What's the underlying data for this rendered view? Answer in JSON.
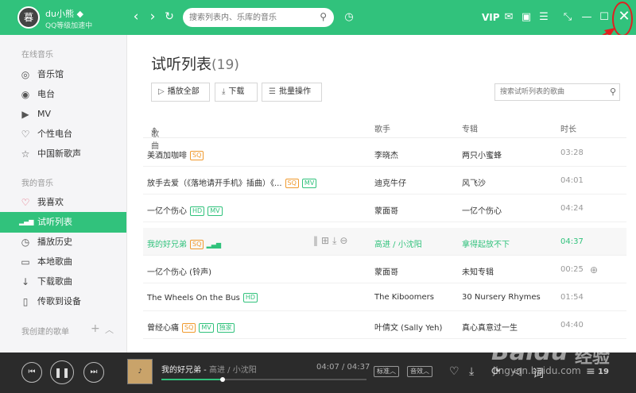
{
  "app": {
    "user_name": "du小熊",
    "user_status": "QQ等级加速中",
    "avatar_text": "暮",
    "search_placeholder": "搜索列表内、乐库的音乐",
    "vip_label": "VIP"
  },
  "sidebar": {
    "sections": [
      {
        "title": "在线音乐",
        "items": [
          {
            "icon": "music-hall-icon",
            "glyph": "◎",
            "label": "音乐馆"
          },
          {
            "icon": "radio-icon",
            "glyph": "◉",
            "label": "电台"
          },
          {
            "icon": "mv-icon",
            "glyph": "▶",
            "label": "MV"
          },
          {
            "icon": "personal-radio-icon",
            "glyph": "♡",
            "label": "个性电台"
          },
          {
            "icon": "new-songs-icon",
            "glyph": "☆",
            "label": "中国新歌声"
          }
        ]
      },
      {
        "title": "我的音乐",
        "items": [
          {
            "icon": "heart-icon",
            "glyph": "♡",
            "label": "我喜欢"
          },
          {
            "icon": "equalizer-icon",
            "glyph": "▮",
            "label": "试听列表",
            "active": true
          },
          {
            "icon": "history-icon",
            "glyph": "◷",
            "label": "播放历史"
          },
          {
            "icon": "local-music-icon",
            "glyph": "▭",
            "label": "本地歌曲"
          },
          {
            "icon": "download-icon",
            "glyph": "↓",
            "label": "下载歌曲"
          },
          {
            "icon": "device-icon",
            "glyph": "▯",
            "label": "传歌到设备"
          }
        ]
      },
      {
        "title": "我创建的歌单",
        "items": []
      }
    ]
  },
  "main": {
    "title": "试听列表",
    "count": "(19)",
    "toolbar": {
      "play_all": "播放全部",
      "download": "下载",
      "batch": "批量操作",
      "search_placeholder": "搜索试听列表的歌曲"
    },
    "columns": {
      "song": "歌曲",
      "artist": "歌手",
      "album": "专辑",
      "duration": "时长"
    },
    "songs": [
      {
        "title": "美酒加咖啡",
        "tags": [
          "SQ"
        ],
        "artist": "李晓杰",
        "album": "两只小蜜蜂",
        "duration": "03:28"
      },
      {
        "title": "放手去爱（《落地请开手机》插曲）《...",
        "tags": [
          "SQ",
          "MV"
        ],
        "artist": "迪克牛仔",
        "album": "风飞沙",
        "duration": "04:01"
      },
      {
        "title": "一亿个伤心",
        "tags": [
          "HD",
          "MV"
        ],
        "artist": "蒙面哥",
        "album": "一亿个伤心",
        "duration": "04:24"
      },
      {
        "title": "我的好兄弟",
        "tags": [
          "SQ"
        ],
        "artist": "高进 / 小沈阳",
        "album": "拿得起放不下",
        "duration": "04:37",
        "playing": true
      },
      {
        "title": "一亿个伤心 (铃声)",
        "tags": [],
        "artist": "蒙面哥",
        "album": "未知专辑",
        "duration": "00:25"
      },
      {
        "title": "The Wheels On the Bus",
        "tags": [
          "HD"
        ],
        "artist": "The Kiboomers",
        "album": "30 Nursery Rhymes",
        "duration": "01:54"
      },
      {
        "title": "曾经心痛",
        "tags": [
          "SQ",
          "MV",
          "独家"
        ],
        "artist": "叶倩文 (Sally Yeh)",
        "album": "真心真意过一生",
        "duration": "04:40"
      }
    ]
  },
  "player": {
    "track_title": "我的好兄弟",
    "track_artist": "高进 / 小沈阳",
    "time": "04:07 / 04:37",
    "quality": "标准",
    "effect": "音效",
    "progress": 0.3,
    "list_count": "19"
  },
  "watermark": {
    "brand": "Baidu",
    "label": "经验",
    "url": "jingyan.baidu.com"
  },
  "colors": {
    "accent": "#31c27c",
    "sq_tag": "#f09a2e",
    "annotation": "#e02020"
  }
}
